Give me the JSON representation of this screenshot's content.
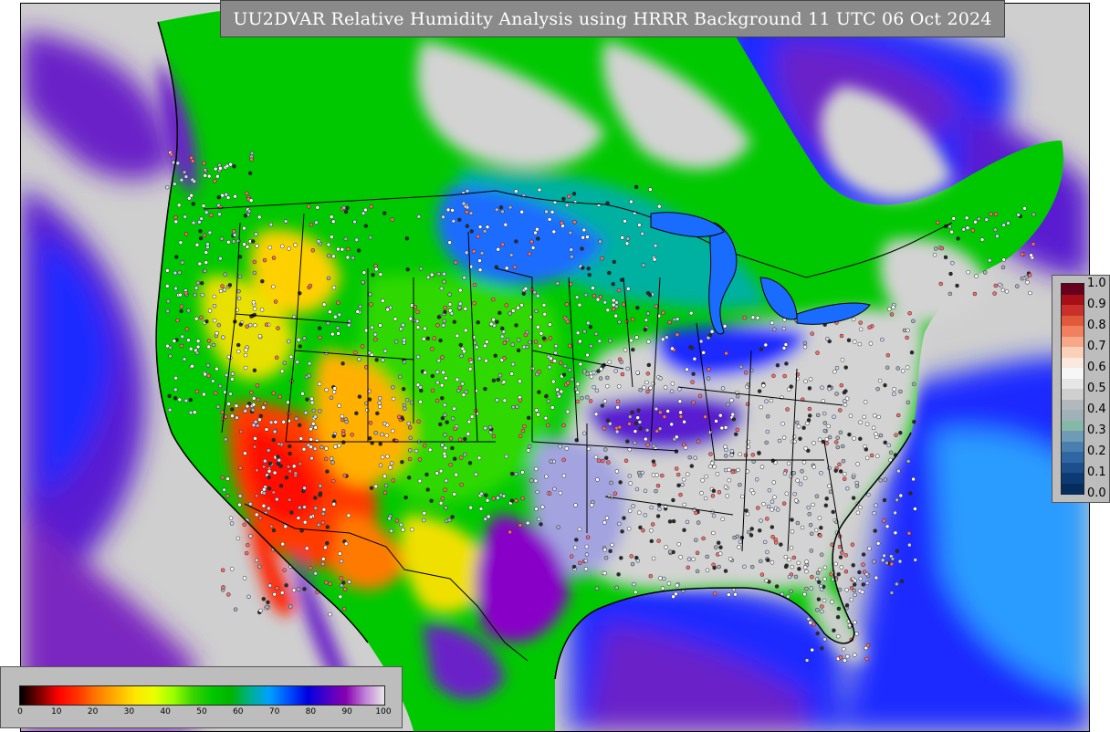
{
  "title": "UU2DVAR Relative Humidity Analysis using HRRR Background 11 UTC 06 Oct 2024",
  "colors": {
    "land_dry": "#ff0000",
    "land_moist": "#00c800",
    "ocean_humid": "#1a1aff",
    "saturated": "#d3d3d3",
    "border": "#000000"
  },
  "right_colorbar": {
    "ticks": [
      "1.0",
      "0.9",
      "0.8",
      "0.7",
      "0.6",
      "0.5",
      "0.4",
      "0.3",
      "0.2",
      "0.1",
      "0.0"
    ],
    "colors": [
      "#67001f",
      "#a50f15",
      "#c9302c",
      "#e05a3a",
      "#f08060",
      "#f7a889",
      "#fbd0b9",
      "#fbe8df",
      "#f7f7f7",
      "#e6e6e6",
      "#cfcfcf",
      "#b3b8bc",
      "#9fb2b9",
      "#86b8a8",
      "#6e9bb5",
      "#4a7fb0",
      "#2f67a4",
      "#1c4f8c",
      "#0c3a75",
      "#052c5d"
    ]
  },
  "bottom_colorbar": {
    "ticks": [
      "0",
      "10",
      "20",
      "30",
      "40",
      "50",
      "60",
      "70",
      "80",
      "90",
      "100"
    ],
    "gradient": [
      "#000000",
      "#7a0000",
      "#ff0000",
      "#ff3300",
      "#ff7a00",
      "#ffb000",
      "#ffe600",
      "#eaff00",
      "#9aff00",
      "#3cd400",
      "#00c800",
      "#00b400",
      "#00b090",
      "#00a0ff",
      "#0050ff",
      "#0000e0",
      "#4b00c8",
      "#8800b0",
      "#c080d8",
      "#e8e8e8"
    ]
  }
}
